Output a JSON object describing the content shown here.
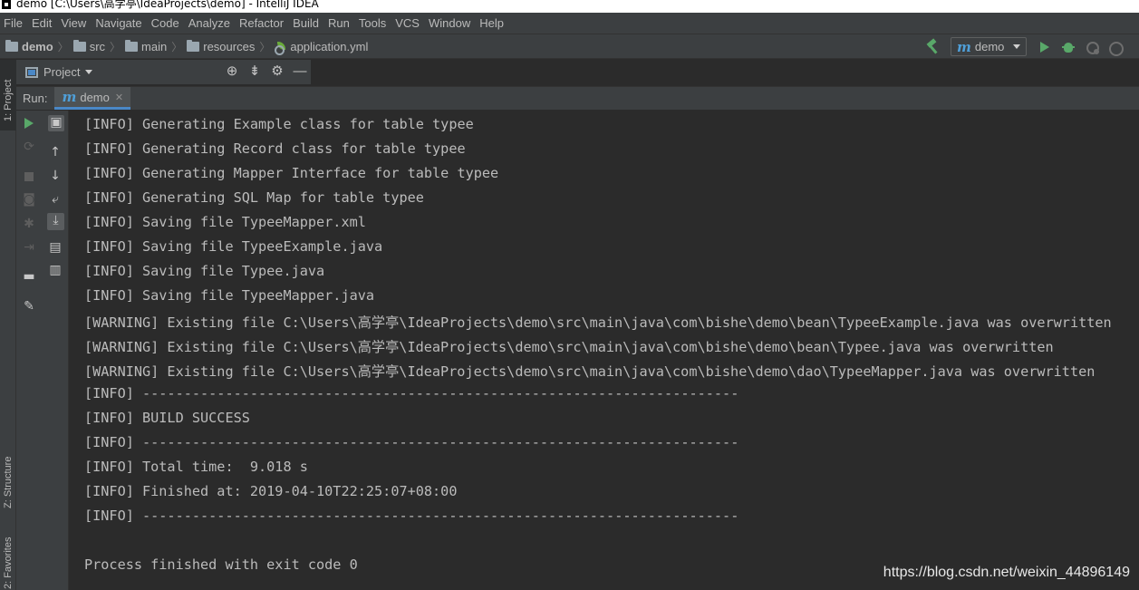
{
  "window": {
    "title": "demo [C:\\Users\\高学亭\\IdeaProjects\\demo] - IntelliJ IDEA"
  },
  "menu": [
    "File",
    "Edit",
    "View",
    "Navigate",
    "Code",
    "Analyze",
    "Refactor",
    "Build",
    "Run",
    "Tools",
    "VCS",
    "Window",
    "Help"
  ],
  "breadcrumbs": [
    "demo",
    "src",
    "main",
    "resources",
    "application.yml"
  ],
  "run_config": {
    "name": "demo"
  },
  "left_tabs": {
    "project": "1: Project",
    "structure": "Z: Structure",
    "favorites": "2: Favorites"
  },
  "project_panel": {
    "title": "Project"
  },
  "run_panel": {
    "label": "Run:",
    "tab": "demo"
  },
  "console": {
    "lines": [
      "[INFO] Generating Example class for table typee",
      "[INFO] Generating Record class for table typee",
      "[INFO] Generating Mapper Interface for table typee",
      "[INFO] Generating SQL Map for table typee",
      "[INFO] Saving file TypeeMapper.xml",
      "[INFO] Saving file TypeeExample.java",
      "[INFO] Saving file Typee.java",
      "[INFO] Saving file TypeeMapper.java",
      "[WARNING] Existing file C:\\Users\\高学亭\\IdeaProjects\\demo\\src\\main\\java\\com\\bishe\\demo\\bean\\TypeeExample.java was overwritten",
      "[WARNING] Existing file C:\\Users\\高学亭\\IdeaProjects\\demo\\src\\main\\java\\com\\bishe\\demo\\bean\\Typee.java was overwritten",
      "[WARNING] Existing file C:\\Users\\高学亭\\IdeaProjects\\demo\\src\\main\\java\\com\\bishe\\demo\\dao\\TypeeMapper.java was overwritten",
      "[INFO] ------------------------------------------------------------------------",
      "[INFO] BUILD SUCCESS",
      "[INFO] ------------------------------------------------------------------------",
      "[INFO] Total time:  9.018 s",
      "[INFO] Finished at: 2019-04-10T22:25:07+08:00",
      "[INFO] ------------------------------------------------------------------------",
      "",
      "Process finished with exit code 0"
    ]
  },
  "watermark": "https://blog.csdn.net/weixin_44896149",
  "colors": {
    "accent": "#4a88c7",
    "run_green": "#59a869",
    "bg_dark": "#2b2b2b",
    "panel": "#3c3f41"
  }
}
